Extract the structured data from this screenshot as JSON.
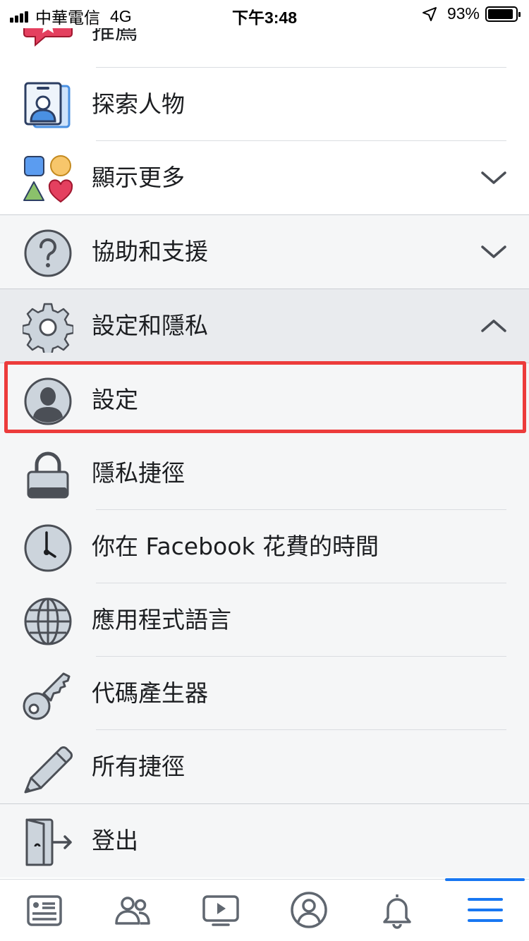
{
  "status_bar": {
    "carrier": "中華電信",
    "network": "4G",
    "time": "下午3:48",
    "battery": "93%",
    "battery_level": 0.93
  },
  "menu": {
    "recommendations": {
      "label": "推薦",
      "icon": "recommendations-icon"
    },
    "find_friends": {
      "label": "探索人物",
      "icon": "contact-card-icon"
    },
    "see_more": {
      "label": "顯示更多",
      "icon": "shapes-icon"
    },
    "help_support": {
      "label": "協助和支援",
      "icon": "question-icon"
    },
    "settings_privacy": {
      "label": "設定和隱私",
      "icon": "gear-icon"
    },
    "settings": {
      "label": "設定",
      "icon": "user-avatar-icon"
    },
    "privacy_shortcuts": {
      "label": "隱私捷徑",
      "icon": "lock-icon"
    },
    "time_on_facebook": {
      "label": "你在 Facebook 花費的時間",
      "icon": "clock-icon"
    },
    "app_language": {
      "label": "應用程式語言",
      "icon": "globe-icon"
    },
    "code_generator": {
      "label": "代碼產生器",
      "icon": "key-icon"
    },
    "all_shortcuts": {
      "label": "所有捷徑",
      "icon": "pencil-icon"
    },
    "logout": {
      "label": "登出",
      "icon": "door-exit-icon"
    }
  },
  "tabbar": {
    "tabs": [
      "news-feed-icon",
      "friends-icon",
      "watch-icon",
      "profile-icon",
      "notifications-icon",
      "menu-icon"
    ],
    "active": "menu-icon"
  },
  "colors": {
    "accent": "#1877f2",
    "highlight_border": "#ec3b3b",
    "icon_gray": "#606770"
  }
}
